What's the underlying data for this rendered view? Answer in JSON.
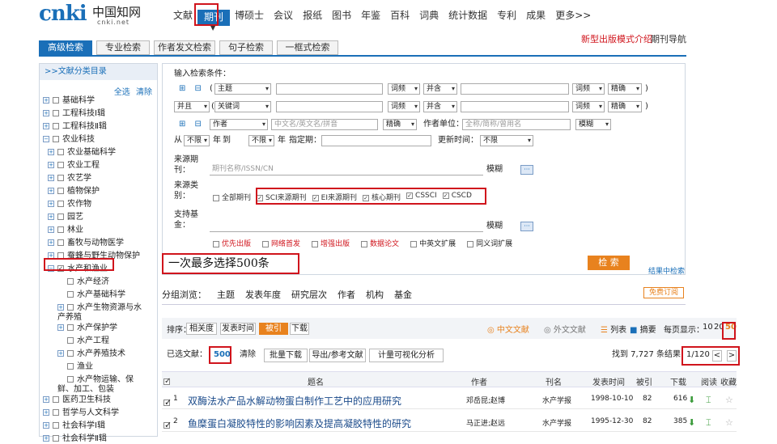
{
  "logo": {
    "mark": "cnki",
    "cn_name": "中国知网",
    "url": "cnki.net"
  },
  "top_nav": [
    "文献",
    "期刊",
    "博硕士",
    "会议",
    "报纸",
    "图书",
    "年鉴",
    "百科",
    "词典",
    "统计数据",
    "专利",
    "成果",
    "更多>>"
  ],
  "top_nav_active": "期刊",
  "right_links": {
    "new_version": "新型出版模式介绍",
    "journal_nav": "期刊导航"
  },
  "search_tabs": [
    "高级检索",
    "专业检索",
    "作者发文检索",
    "句子检索",
    "一框式检索"
  ],
  "sidebar": {
    "header": ">>文献分类目录",
    "select_all": "全选",
    "clear": "清除",
    "items": [
      {
        "label": "基础科学",
        "level": 0,
        "expander": "+",
        "checked": false
      },
      {
        "label": "工程科技Ⅰ辑",
        "level": 0,
        "expander": "+",
        "checked": false
      },
      {
        "label": "工程科技Ⅱ辑",
        "level": 0,
        "expander": "+",
        "checked": false
      },
      {
        "label": "农业科技",
        "level": 0,
        "expander": "−",
        "checked": false
      },
      {
        "label": "农业基础科学",
        "level": 1,
        "expander": "+",
        "checked": false
      },
      {
        "label": "农业工程",
        "level": 1,
        "expander": "+",
        "checked": false
      },
      {
        "label": "农艺学",
        "level": 1,
        "expander": "+",
        "checked": false
      },
      {
        "label": "植物保护",
        "level": 1,
        "expander": "+",
        "checked": false
      },
      {
        "label": "农作物",
        "level": 1,
        "expander": "+",
        "checked": false
      },
      {
        "label": "园艺",
        "level": 1,
        "expander": "+",
        "checked": false
      },
      {
        "label": "林业",
        "level": 1,
        "expander": "+",
        "checked": false
      },
      {
        "label": "畜牧与动物医学",
        "level": 1,
        "expander": "+",
        "checked": false
      },
      {
        "label": "蚕蜂与野生动物保护",
        "level": 1,
        "expander": "+",
        "checked": false
      },
      {
        "label": "水产和渔业",
        "level": 1,
        "expander": "−",
        "checked": true
      },
      {
        "label": "水产经济",
        "level": 2,
        "expander": "",
        "checked": false
      },
      {
        "label": "水产基础科学",
        "level": 2,
        "expander": "",
        "checked": false
      },
      {
        "label": "水产生物资源与水产养殖",
        "level": 2,
        "expander": "+",
        "checked": false
      },
      {
        "label": "水产保护学",
        "level": 2,
        "expander": "+",
        "checked": false
      },
      {
        "label": "水产工程",
        "level": 2,
        "expander": "",
        "checked": false
      },
      {
        "label": "水产养殖技术",
        "level": 2,
        "expander": "+",
        "checked": false
      },
      {
        "label": "渔业",
        "level": 2,
        "expander": "",
        "checked": false
      },
      {
        "label": "水产物运输、保鲜、加工、包装",
        "level": 2,
        "expander": "",
        "checked": false
      },
      {
        "label": "医药卫生科技",
        "level": 0,
        "expander": "+",
        "checked": false
      },
      {
        "label": "哲学与人文科学",
        "level": 0,
        "expander": "+",
        "checked": false
      },
      {
        "label": "社会科学Ⅰ辑",
        "level": 0,
        "expander": "+",
        "checked": false
      },
      {
        "label": "社会科学Ⅱ辑",
        "level": 0,
        "expander": "+",
        "checked": false
      }
    ]
  },
  "form": {
    "title": "输入检索条件：",
    "row1": {
      "field": "主题",
      "freq": "词频",
      "logic": "并含",
      "precision": "精确"
    },
    "row2": {
      "bool": "并且",
      "field": "关键词",
      "freq": "词频",
      "logic": "并含",
      "precision": "精确"
    },
    "row3": {
      "field": "作者",
      "placeholder_name": "中文名/英文名/拼音",
      "precision": "精确",
      "org_label": "作者单位：",
      "org_placeholder": "全称/简称/曾用名",
      "org_precision": "模糊"
    },
    "row4": {
      "from_label": "从",
      "year_from": "不限",
      "year_unit1": "年",
      "to_label": "到",
      "year_to": "不限",
      "year_unit2": "年",
      "date_label": "指定期：",
      "update_label": "更新时间：",
      "update_value": "不限"
    },
    "source": {
      "label": "来源期刊：",
      "placeholder": "期刊名称/ISSN/CN",
      "precision": "模糊",
      "more": "···"
    },
    "category": {
      "label": "来源类别：",
      "options": [
        {
          "label": "全部期刊",
          "checked": false
        },
        {
          "label": "SCI来源期刊",
          "checked": true
        },
        {
          "label": "EI来源期刊",
          "checked": true
        },
        {
          "label": "核心期刊",
          "checked": true
        },
        {
          "label": "CSSCI",
          "checked": true
        },
        {
          "label": "CSCD",
          "checked": true
        }
      ]
    },
    "fund": {
      "label": "支持基金：",
      "precision": "模糊",
      "more": "···"
    },
    "extra_options": [
      "优先出版",
      "网络首发",
      "增强出版",
      "数据论文",
      "中英文扩展",
      "同义词扩展"
    ],
    "search_button": "检 索",
    "result_search_link": "结果中检索"
  },
  "annotation": "一次最多选择500条",
  "group_bar": {
    "items": [
      "分组浏览：",
      "主题",
      "发表年度",
      "研究层次",
      "作者",
      "机构",
      "基金"
    ],
    "subscribe": "免费订阅"
  },
  "results_bar": {
    "sort_label": "排序：",
    "sort_options": [
      "相关度",
      "发表时间",
      "被引",
      "下载"
    ],
    "sort_active": "被引",
    "lang_cn": "中文文献",
    "lang_en": "外文文献",
    "view_list": "列表",
    "view_abstract": "摘要",
    "per_page_label": "每页显示：",
    "per_page_options": [
      "10",
      "20",
      "50"
    ],
    "per_page_active": "50"
  },
  "actions": {
    "selected_label": "已选文献：",
    "selected_count": "500",
    "clear": "清除",
    "bulk_download": "批量下载",
    "export": "导出/参考文献",
    "visualize": "计量可视化分析",
    "found_text": "找到 7,727 条结果",
    "page_indicator": "1/120",
    "prev": "<",
    "next": ">"
  },
  "table": {
    "headers": [
      "题名",
      "作者",
      "刊名",
      "发表时间",
      "被引",
      "下载",
      "阅读",
      "收藏"
    ],
    "rows": [
      {
        "index": "1",
        "title": "双酶法水产品水解动物蛋白制作工艺中的应用研究",
        "author": "邓岳昆;赵博",
        "journal": "水产学报",
        "date": "1998-10-10",
        "cited": "82",
        "downloads": "616"
      },
      {
        "index": "2",
        "title": "鱼糜蛋白凝胶特性的影响因素及提高凝胶特性的研究",
        "author": "马正进;赵远",
        "journal": "水产学报",
        "date": "1995-12-30",
        "cited": "82",
        "downloads": "385"
      }
    ]
  }
}
